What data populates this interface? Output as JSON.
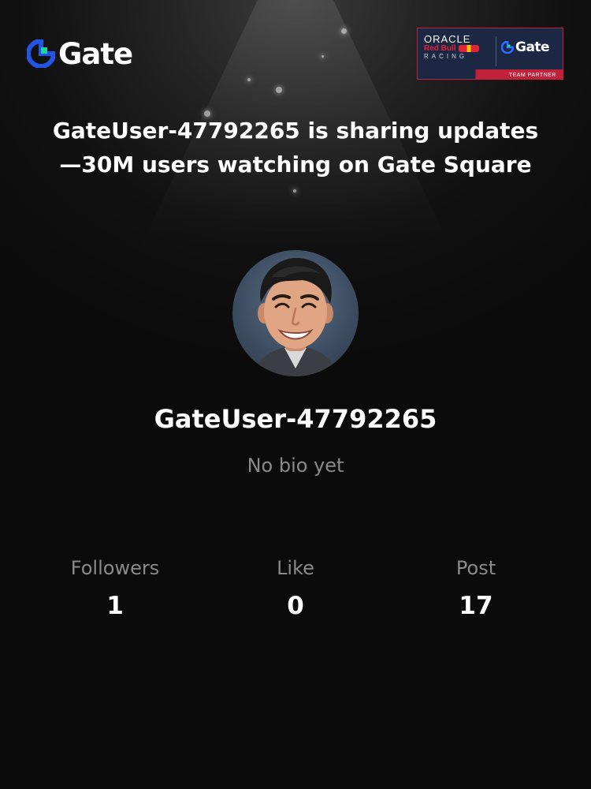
{
  "brand": {
    "name": "Gate",
    "color": "#2354e6",
    "accent": "#1fd1a3",
    "icon": "gate-logo-icon"
  },
  "partner": {
    "oracle": "ORACLE",
    "redbull": "Red Bull",
    "racing": "RACING",
    "gate": "Gate",
    "team": "TEAM PARTNER",
    "icon": "oracle-redbull-racing-badge"
  },
  "headline": {
    "line1": "GateUser-47792265 is sharing updates",
    "line2": "—30M users watching on Gate Square"
  },
  "profile": {
    "avatar_icon": "user-avatar",
    "username": "GateUser-47792265",
    "bio": "No bio yet"
  },
  "stats": [
    {
      "label": "Followers",
      "value": "1"
    },
    {
      "label": "Like",
      "value": "0"
    },
    {
      "label": "Post",
      "value": "17"
    }
  ]
}
